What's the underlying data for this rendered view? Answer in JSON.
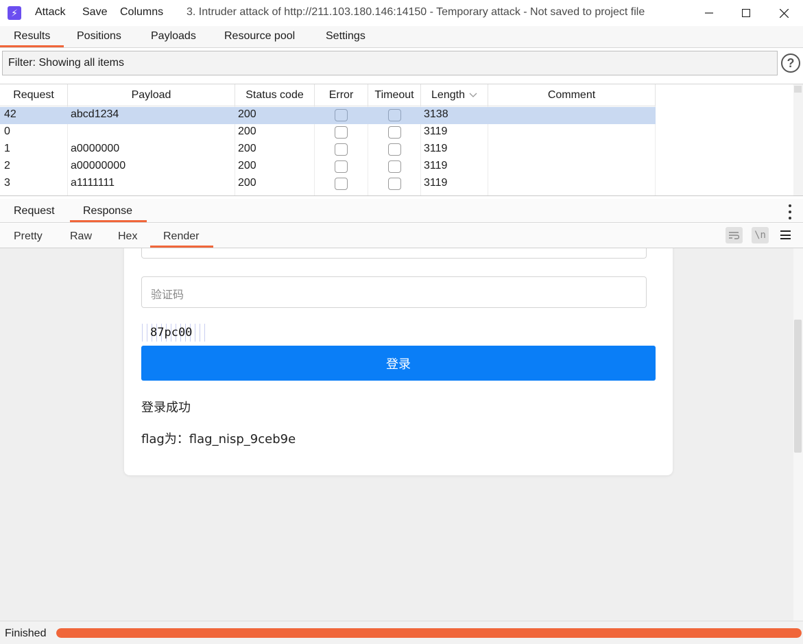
{
  "menu": {
    "attack": "Attack",
    "save": "Save",
    "columns": "Columns"
  },
  "window_title": "3. Intruder attack of http://211.103.180.146:14150 - Temporary attack - Not saved to project file",
  "top_tabs": [
    "Results",
    "Positions",
    "Payloads",
    "Resource pool",
    "Settings"
  ],
  "active_top_tab": "Results",
  "filter_text": "Filter: Showing all items",
  "table": {
    "headers": [
      "Request",
      "Payload",
      "Status code",
      "Error",
      "Timeout",
      "Length",
      "Comment"
    ],
    "sort_column": "Length",
    "rows": [
      {
        "request": "42",
        "payload": "abcd1234",
        "status": "200",
        "length": "3138",
        "selected": true
      },
      {
        "request": "0",
        "payload": "",
        "status": "200",
        "length": "3119",
        "selected": false
      },
      {
        "request": "1",
        "payload": "a0000000",
        "status": "200",
        "length": "3119",
        "selected": false
      },
      {
        "request": "2",
        "payload": "a00000000",
        "status": "200",
        "length": "3119",
        "selected": false
      },
      {
        "request": "3",
        "payload": "a1111111",
        "status": "200",
        "length": "3119",
        "selected": false
      }
    ]
  },
  "rr_tabs": [
    "Request",
    "Response"
  ],
  "active_rr_tab": "Response",
  "sub_tabs": [
    "Pretty",
    "Raw",
    "Hex",
    "Render"
  ],
  "active_sub_tab": "Render",
  "tool_buttons": {
    "wrap_icon": "wrap-lines-icon",
    "newline": "\\n"
  },
  "render": {
    "captcha_placeholder": "验证码",
    "captcha_text": "87pc00",
    "login_button": "登录",
    "success_msg": "登录成功",
    "flag_msg": "flag为：flag_nisp_9ceb9e"
  },
  "status": {
    "text": "Finished",
    "progress": 1.0
  },
  "colors": {
    "accent": "#f0663a",
    "selected_row": "#c9d9f1",
    "login_btn": "#0a7ef7"
  }
}
